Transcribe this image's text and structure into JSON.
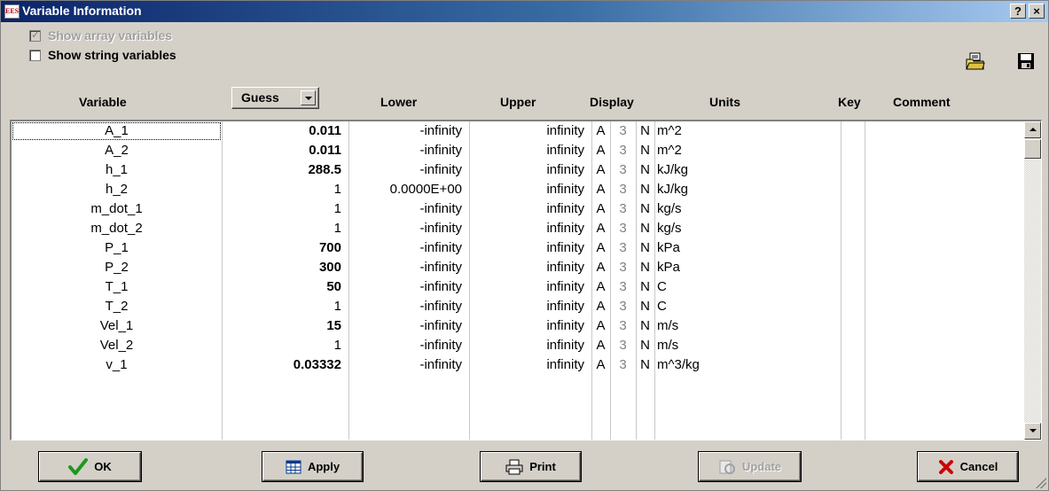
{
  "window": {
    "app_icon_text": "EES",
    "title": "Variable Information",
    "help_label": "?",
    "close_label": "×"
  },
  "options": {
    "show_array_label": "Show array variables",
    "show_array_checked": true,
    "show_array_enabled": false,
    "show_string_label": "Show string variables",
    "show_string_checked": false
  },
  "icons": {
    "open": "open-folder-icon",
    "save": "save-disk-icon"
  },
  "columns": {
    "variable": "Variable",
    "guess_select": "Guess",
    "lower": "Lower",
    "upper": "Upper",
    "display": "Display",
    "units": "Units",
    "key": "Key",
    "comment": "Comment"
  },
  "rows": [
    {
      "variable": "A_1",
      "guess": "0.011",
      "guess_bold": true,
      "lower": "-infinity",
      "upper": "infinity",
      "d1": "A",
      "d2": "3",
      "d3": "N",
      "units": "m^2",
      "key": "",
      "comment": ""
    },
    {
      "variable": "A_2",
      "guess": "0.011",
      "guess_bold": true,
      "lower": "-infinity",
      "upper": "infinity",
      "d1": "A",
      "d2": "3",
      "d3": "N",
      "units": "m^2",
      "key": "",
      "comment": ""
    },
    {
      "variable": "h_1",
      "guess": "288.5",
      "guess_bold": true,
      "lower": "-infinity",
      "upper": "infinity",
      "d1": "A",
      "d2": "3",
      "d3": "N",
      "units": "kJ/kg",
      "key": "",
      "comment": ""
    },
    {
      "variable": "h_2",
      "guess": "1",
      "guess_bold": false,
      "lower": "0.0000E+00",
      "upper": "infinity",
      "d1": "A",
      "d2": "3",
      "d3": "N",
      "units": "kJ/kg",
      "key": "",
      "comment": ""
    },
    {
      "variable": "m_dot_1",
      "guess": "1",
      "guess_bold": false,
      "lower": "-infinity",
      "upper": "infinity",
      "d1": "A",
      "d2": "3",
      "d3": "N",
      "units": "kg/s",
      "key": "",
      "comment": ""
    },
    {
      "variable": "m_dot_2",
      "guess": "1",
      "guess_bold": false,
      "lower": "-infinity",
      "upper": "infinity",
      "d1": "A",
      "d2": "3",
      "d3": "N",
      "units": "kg/s",
      "key": "",
      "comment": ""
    },
    {
      "variable": "P_1",
      "guess": "700",
      "guess_bold": true,
      "lower": "-infinity",
      "upper": "infinity",
      "d1": "A",
      "d2": "3",
      "d3": "N",
      "units": "kPa",
      "key": "",
      "comment": ""
    },
    {
      "variable": "P_2",
      "guess": "300",
      "guess_bold": true,
      "lower": "-infinity",
      "upper": "infinity",
      "d1": "A",
      "d2": "3",
      "d3": "N",
      "units": "kPa",
      "key": "",
      "comment": ""
    },
    {
      "variable": "T_1",
      "guess": "50",
      "guess_bold": true,
      "lower": "-infinity",
      "upper": "infinity",
      "d1": "A",
      "d2": "3",
      "d3": "N",
      "units": "C",
      "key": "",
      "comment": ""
    },
    {
      "variable": "T_2",
      "guess": "1",
      "guess_bold": false,
      "lower": "-infinity",
      "upper": "infinity",
      "d1": "A",
      "d2": "3",
      "d3": "N",
      "units": "C",
      "key": "",
      "comment": ""
    },
    {
      "variable": "Vel_1",
      "guess": "15",
      "guess_bold": true,
      "lower": "-infinity",
      "upper": "infinity",
      "d1": "A",
      "d2": "3",
      "d3": "N",
      "units": "m/s",
      "key": "",
      "comment": ""
    },
    {
      "variable": "Vel_2",
      "guess": "1",
      "guess_bold": false,
      "lower": "-infinity",
      "upper": "infinity",
      "d1": "A",
      "d2": "3",
      "d3": "N",
      "units": "m/s",
      "key": "",
      "comment": ""
    },
    {
      "variable": "v_1",
      "guess": "0.03332",
      "guess_bold": true,
      "lower": "-infinity",
      "upper": "infinity",
      "d1": "A",
      "d2": "3",
      "d3": "N",
      "units": "m^3/kg",
      "key": "",
      "comment": ""
    }
  ],
  "buttons": {
    "ok": "OK",
    "apply": "Apply",
    "print": "Print",
    "update": "Update",
    "update_enabled": false,
    "cancel": "Cancel"
  },
  "colors": {
    "ok_check": "#1a9a1a",
    "cancel_x": "#cc0000",
    "titlebar_start": "#0a246a"
  }
}
